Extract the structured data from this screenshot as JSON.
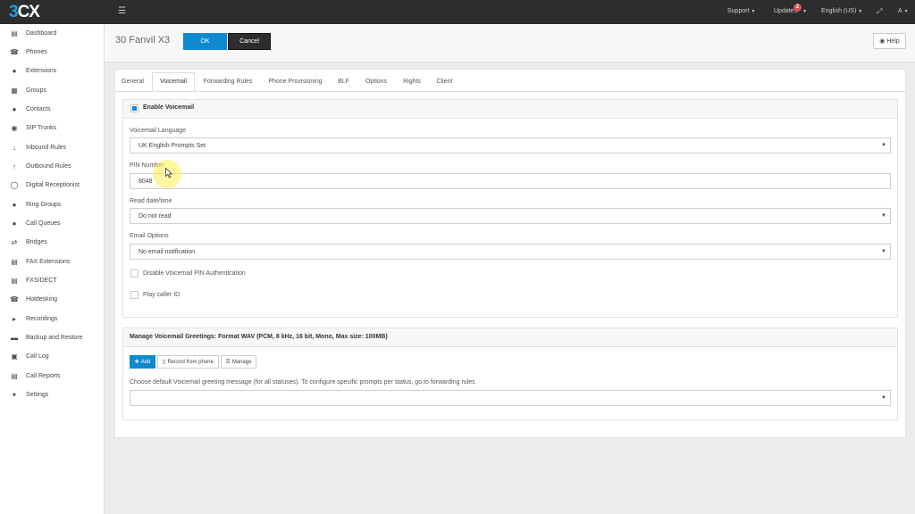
{
  "topbar": {
    "logo_3": "3",
    "logo_cx": "CX",
    "support": "Support",
    "updates": "Updates",
    "updates_badge": "2",
    "language": "English (US)",
    "user_initial": "A"
  },
  "sidebar": {
    "items": [
      {
        "label": "Dashboard",
        "icon": "bar-chart-icon"
      },
      {
        "label": "Phones",
        "icon": "phone-icon"
      },
      {
        "label": "Extensions",
        "icon": "user-icon"
      },
      {
        "label": "Groups",
        "icon": "grid-icon"
      },
      {
        "label": "Contacts",
        "icon": "user-icon"
      },
      {
        "label": "SIP Trunks",
        "icon": "globe-icon"
      },
      {
        "label": "Inbound Rules",
        "icon": "arrow-down-icon"
      },
      {
        "label": "Outbound Rules",
        "icon": "arrow-up-icon"
      },
      {
        "label": "Digital Receptionist",
        "icon": "headset-icon"
      },
      {
        "label": "Ring Groups",
        "icon": "users-icon"
      },
      {
        "label": "Call Queues",
        "icon": "users-icon"
      },
      {
        "label": "Bridges",
        "icon": "exchange-icon"
      },
      {
        "label": "FAX Extensions",
        "icon": "fax-icon"
      },
      {
        "label": "FXS/DECT",
        "icon": "fax-icon"
      },
      {
        "label": "Hotdesking",
        "icon": "phone-icon"
      },
      {
        "label": "Recordings",
        "icon": "volume-icon"
      },
      {
        "label": "Backup and Restore",
        "icon": "folder-icon"
      },
      {
        "label": "Call Log",
        "icon": "book-icon"
      },
      {
        "label": "Call Reports",
        "icon": "report-icon"
      },
      {
        "label": "Settings",
        "icon": "wrench-icon"
      }
    ]
  },
  "header": {
    "title": "30 Fanvil X3",
    "ok_label": "OK",
    "cancel_label": "Cancel",
    "help_label": "Help"
  },
  "tabs": [
    {
      "label": "General",
      "active": false
    },
    {
      "label": "Voicemail",
      "active": true
    },
    {
      "label": "Forwarding Rules",
      "active": false
    },
    {
      "label": "Phone Provisioning",
      "active": false
    },
    {
      "label": "BLF",
      "active": false
    },
    {
      "label": "Options",
      "active": false
    },
    {
      "label": "Rights",
      "active": false
    },
    {
      "label": "Client",
      "active": false
    }
  ],
  "voicemail": {
    "enable_label": "Enable Voicemail",
    "enable_checked": true,
    "language_label": "Voicemail Language",
    "language_value": "UK English Prompts Set",
    "pin_label": "PIN Number",
    "pin_value": "8048",
    "read_datetime_label": "Read date/time",
    "read_datetime_value": "Do not read",
    "email_options_label": "Email Options",
    "email_options_value": "No email notification",
    "disable_pin_label": "Disable Voicemail PIN Authentication",
    "disable_pin_checked": false,
    "play_caller_id_label": "Play caller ID",
    "play_caller_id_checked": false
  },
  "greetings": {
    "header": "Manage Voicemail Greetings: Format WAV (PCM, 8 kHz, 16 bit, Mono, Max size: 100MB)",
    "add_label": "Add",
    "record_label": "Record from phone",
    "manage_label": "Manage",
    "default_greeting_label": "Choose default Voicemail greeting message (for all statuses). To configure specific prompts per status, go to forwarding rules",
    "default_greeting_value": ""
  },
  "colors": {
    "accent": "#0f8ad2",
    "topbar": "#2d2d2d",
    "cancel": "#2d2d2d",
    "badge": "#d9534f"
  }
}
